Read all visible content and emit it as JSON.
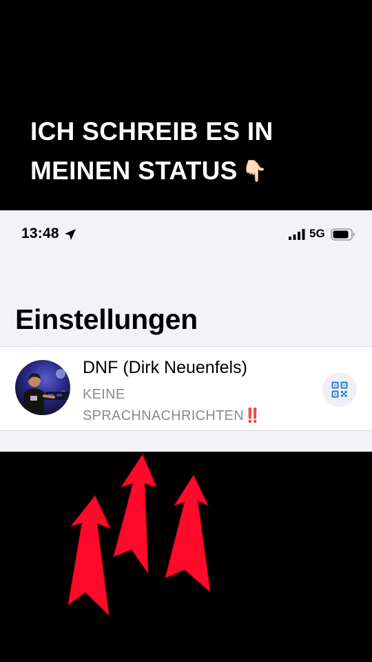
{
  "overlay": {
    "caption_line1": "ICH SCHREIB ES IN",
    "caption_line2": "MEINEN STATUS",
    "caption_emoji": "👇🏻"
  },
  "statusbar": {
    "time": "13:48",
    "network": "5G",
    "icons": [
      "location-arrow-icon",
      "signal-icon",
      "battery-icon"
    ]
  },
  "page": {
    "title": "Einstellungen"
  },
  "profile": {
    "name": "DNF (Dirk Neuenfels)",
    "status_line1": "KEINE",
    "status_line2": "SPRACHNACHRICHTEN",
    "status_emoji": "‼️",
    "icons": [
      "avatar",
      "qr-code-icon"
    ]
  },
  "colors": {
    "background": "#000000",
    "panel": "#f2f2f7",
    "accent": "#1f7ae0",
    "arrow": "#ff0a2a"
  }
}
